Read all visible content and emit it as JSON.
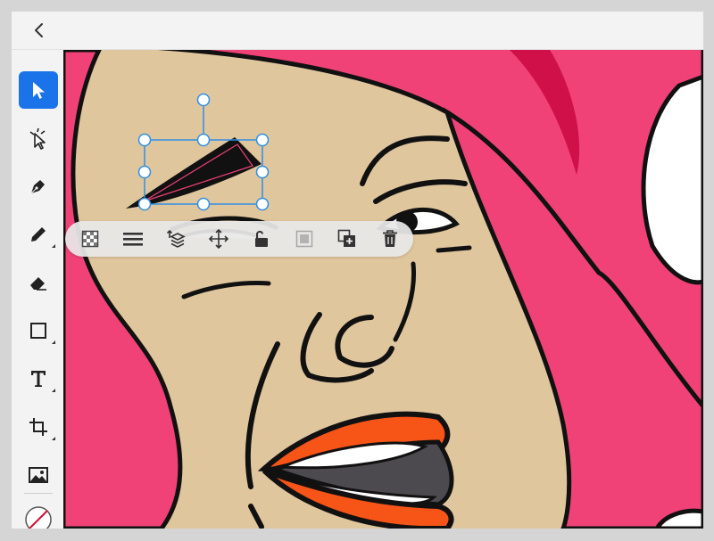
{
  "app": {
    "back_label": "Back",
    "accent_color": "#1a73e8"
  },
  "toolbar": {
    "tools": [
      {
        "name": "select",
        "icon": "arrow-pointer-icon",
        "active": true
      },
      {
        "name": "direct-select",
        "icon": "direct-select-icon",
        "active": false
      },
      {
        "name": "pen",
        "icon": "pen-nib-icon",
        "active": false
      },
      {
        "name": "pencil",
        "icon": "pencil-icon",
        "active": false
      },
      {
        "name": "eraser",
        "icon": "eraser-icon",
        "active": false
      },
      {
        "name": "rectangle",
        "icon": "rectangle-icon",
        "active": false
      },
      {
        "name": "text",
        "icon": "text-t-icon",
        "active": false
      },
      {
        "name": "crop",
        "icon": "crop-icon",
        "active": false
      },
      {
        "name": "image",
        "icon": "image-icon",
        "active": false
      },
      {
        "name": "fill-stroke",
        "icon": "fill-stroke-swatch-icon",
        "active": false
      }
    ]
  },
  "context_toolbar": {
    "actions": [
      {
        "name": "opacity",
        "icon": "checkerboard-icon",
        "enabled": true
      },
      {
        "name": "align",
        "icon": "align-lines-icon",
        "enabled": true
      },
      {
        "name": "arrange",
        "icon": "arrange-layers-icon",
        "enabled": true
      },
      {
        "name": "transform",
        "icon": "move-arrows-icon",
        "enabled": true
      },
      {
        "name": "lock",
        "icon": "unlock-icon",
        "enabled": true
      },
      {
        "name": "mask",
        "icon": "mask-icon",
        "enabled": false
      },
      {
        "name": "duplicate",
        "icon": "duplicate-icon",
        "enabled": true
      },
      {
        "name": "delete",
        "icon": "trash-icon",
        "enabled": true
      }
    ]
  },
  "colors": {
    "skin": "#e0c69d",
    "hair": "#f04277",
    "hair_highlight": "#d01048",
    "lips": "#f75418",
    "teeth_shadow": "#4d4a4f",
    "outline": "#111111",
    "selection": "#2d8fe6"
  }
}
